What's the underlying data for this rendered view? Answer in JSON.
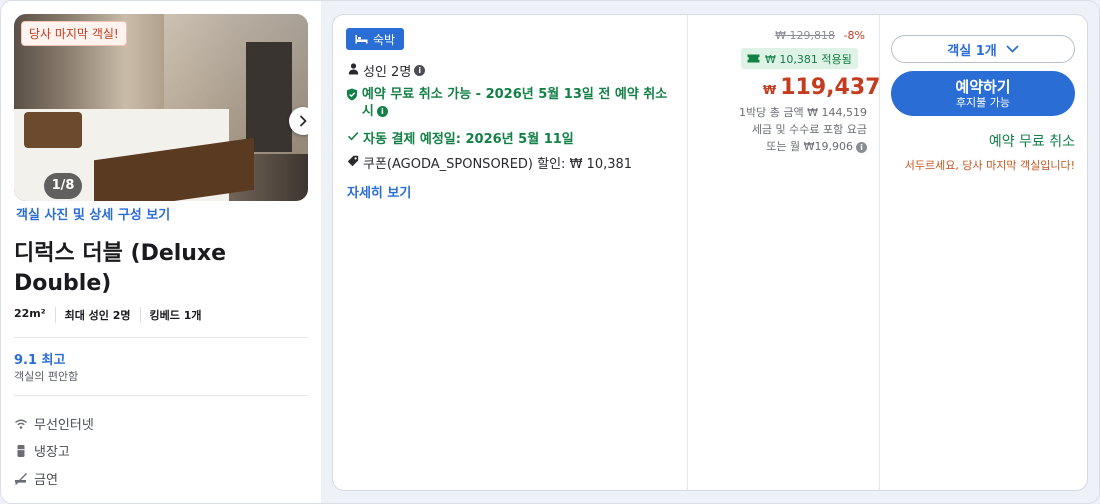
{
  "room": {
    "last_room_badge": "당사 마지막 객실!",
    "photo_counter": "1/8",
    "photo_details_link": "객실 사진 및 상세 구성 보기",
    "title": "디럭스 더블 (Deluxe Double)",
    "specs": [
      "22m²",
      "최대 성인 2명",
      "킹베드 1개"
    ],
    "rating_score": "9.1 최고",
    "rating_sub": "객실의 편안함",
    "amenities": [
      "무선인터넷",
      "냉장고",
      "금연"
    ]
  },
  "offer": {
    "type_badge": "숙박",
    "guests": "성인 2명",
    "free_cancel": "예약 무료 취소 가능 - 2026년 5월 13일 전 예약 취소 시",
    "auto_payment": "자동 결제 예정일: 2026년 5월 11일",
    "coupon": "쿠폰(AGODA_SPONSORED) 할인: ₩ 10,381",
    "details_link": "자세히 보기"
  },
  "price": {
    "original": "₩ 129,818",
    "discount": "-8%",
    "applied_badge": "₩ 10,381 적용됨",
    "currency": "₩",
    "amount": "119,437",
    "total_line": "1박당 총 금액 ₩ 144,519",
    "tax_line": "세금 및 수수료 포함 요금",
    "monthly_line": "또는 월 ₩19,906"
  },
  "cta": {
    "room_count": "객실 1개",
    "book_label": "예약하기",
    "book_sub": "후지불 가능",
    "free_cancel": "예약 무료 취소",
    "hurry": "서두르세요, 당사 마지막 객실입니다!"
  },
  "colors": {
    "accent_blue": "#2a6dd4",
    "price_red": "#c43b1f",
    "success_green": "#138047"
  }
}
